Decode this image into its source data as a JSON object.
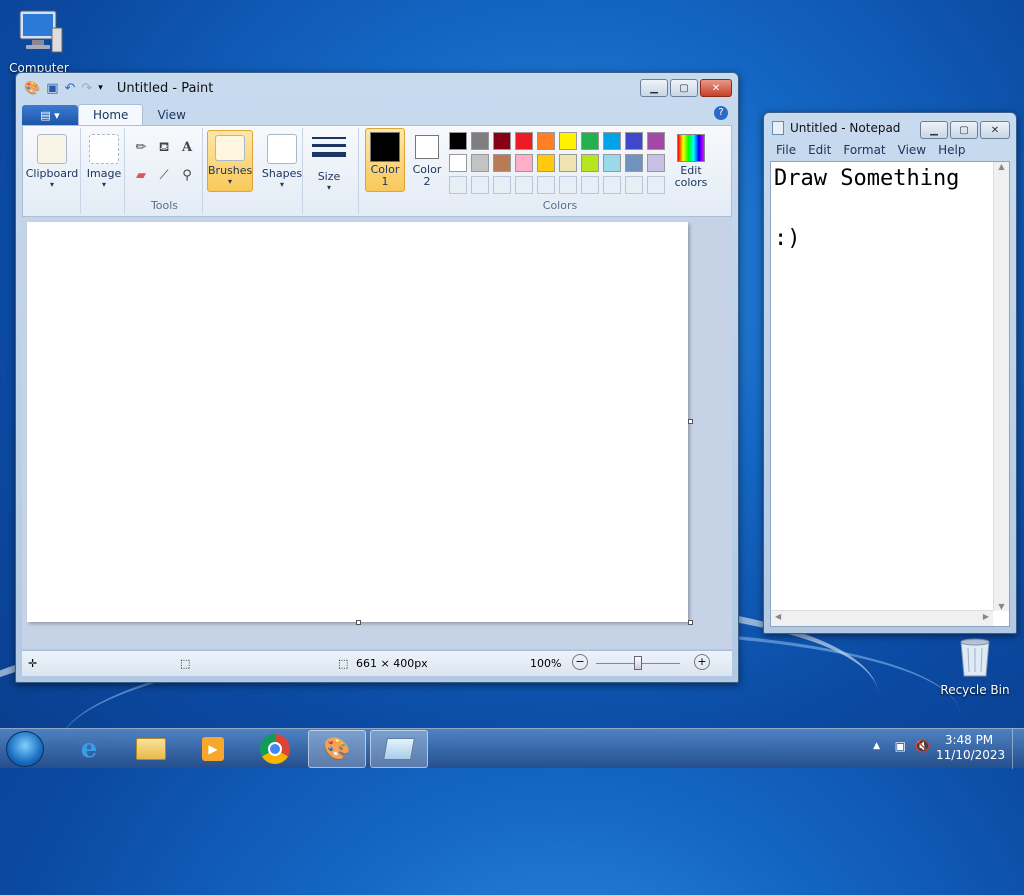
{
  "desktop": {
    "icons": [
      {
        "label": "Computer",
        "icon": "computer-icon"
      },
      {
        "label": "Recycle Bin",
        "icon": "recycle-bin-icon"
      }
    ]
  },
  "paint": {
    "title": "Untitled - Paint",
    "tabs": [
      "Home",
      "View"
    ],
    "groups": {
      "clipboard": "Clipboard",
      "image": "Image",
      "tools": "Tools",
      "brushes": "Brushes",
      "shapes": "Shapes",
      "size": "Size",
      "color1": "Color\n1",
      "color2": "Color\n2",
      "colors": "Colors",
      "edit_colors": "Edit\ncolors"
    },
    "palette_row1": [
      "#000000",
      "#7f7f7f",
      "#880015",
      "#ed1c24",
      "#ff7f27",
      "#fff200",
      "#22b14c",
      "#00a2e8",
      "#3f48cc",
      "#a349a4"
    ],
    "palette_row2": [
      "#ffffff",
      "#c3c3c3",
      "#b97a57",
      "#ffaec9",
      "#ffc90e",
      "#efe4b0",
      "#b5e61d",
      "#99d9ea",
      "#7092be",
      "#c8bfe7"
    ],
    "color1": "#000000",
    "color2": "#ffffff",
    "status": {
      "canvas_size": "661 × 400px",
      "zoom": "100%"
    }
  },
  "notepad": {
    "title": "Untitled - Notepad",
    "menu": [
      "File",
      "Edit",
      "Format",
      "View",
      "Help"
    ],
    "content": "Draw Something\n\n:)"
  },
  "taskbar": {
    "time": "3:48 PM",
    "date": "11/10/2023",
    "apps": [
      "start-button",
      "internet-explorer",
      "file-explorer",
      "media-player",
      "chrome",
      "paint",
      "notepad"
    ]
  }
}
